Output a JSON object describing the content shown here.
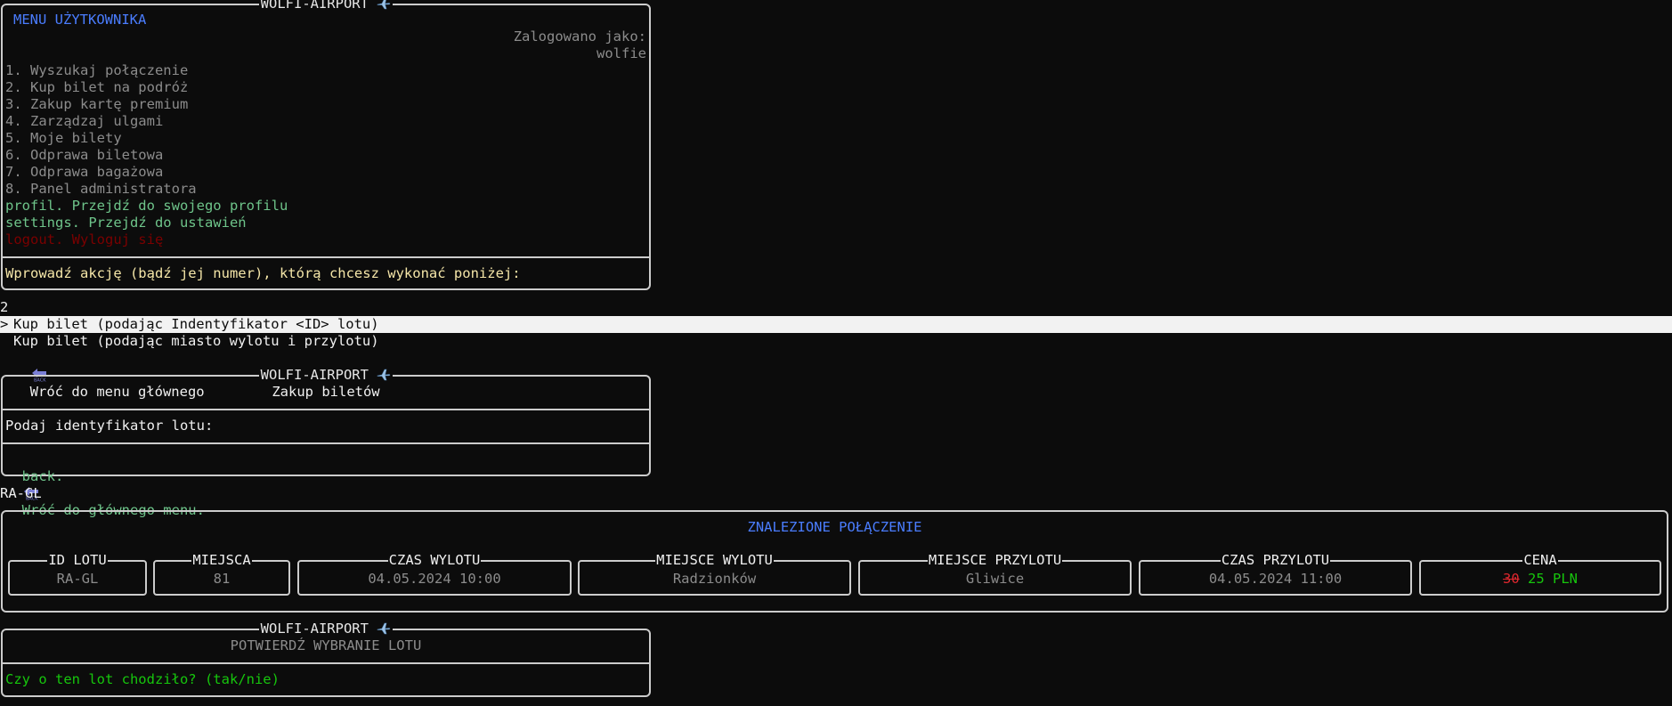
{
  "app_title": "WOLFI-AIRPORT",
  "user_menu": {
    "heading": "MENU UŻYTKOWNIKA",
    "logged_label": "Zalogowano jako:",
    "username": "wolfie",
    "items": [
      "1. Wyszukaj połączenie",
      "2. Kup bilet na podróż",
      "3. Zakup kartę premium",
      "4. Zarządzaj ulgami",
      "5. Moje bilety",
      "6. Odprawa biletowa",
      "7. Odprawa bagażowa",
      "8. Panel administratora"
    ],
    "profile": "profil. Przejdź do swojego profilu",
    "settings": "settings. Przejdź do ustawień",
    "logout": "logout. Wyloguj się",
    "prompt": "Wprowadź akcję (bądź jej numer), którą chcesz wykonać poniżej:"
  },
  "input_1": "2",
  "select_options": {
    "selected_marker": ">",
    "option_1": "Kup bilet (podając Indentyfikator <ID> lotu)",
    "option_2": "Kup bilet (podając miasto wylotu i przylotu)",
    "option_3": "Wróć do menu głównego"
  },
  "purchase_box": {
    "subtitle": "Zakup biletów",
    "prompt": "Podaj identyfikator lotu:",
    "back_cmd": "back.",
    "back_text": "Wróć do głównego menu."
  },
  "input_2": "RA-GL",
  "found": {
    "heading": "ZNALEZIONE POŁĄCZENIE",
    "columns": {
      "id": "ID LOTU",
      "seats": "MIEJSCA",
      "dep_time": "CZAS WYLOTU",
      "dep_place": "MIEJSCE WYLOTU",
      "arr_place": "MIEJSCE PRZYLOTU",
      "arr_time": "CZAS PRZYLOTU",
      "price": "CENA"
    },
    "values": {
      "id": "RA-GL",
      "seats": "81",
      "dep_time": "04.05.2024 10:00",
      "dep_place": "Radzionków",
      "arr_place": "Gliwice",
      "arr_time": "04.05.2024 11:00",
      "price_old": "30",
      "price_new": "25 PLN"
    }
  },
  "confirm_box": {
    "subtitle": "POTWIERDŹ WYBRANIE LOTU",
    "question": "Czy o ten lot chodziło? (tak/nie)"
  },
  "colors": {
    "background": "#0c0c0c",
    "heading_blue": "#4a7dff",
    "menu_green": "#6ec48a",
    "logout_red": "#7a0000",
    "prompt_yellow": "#f5e6a8",
    "price_green": "#16c60c",
    "price_old_red": "#e0272e"
  },
  "icons": {
    "title_icon": "airplane-icon",
    "back_icon": "back-arrow-icon"
  }
}
